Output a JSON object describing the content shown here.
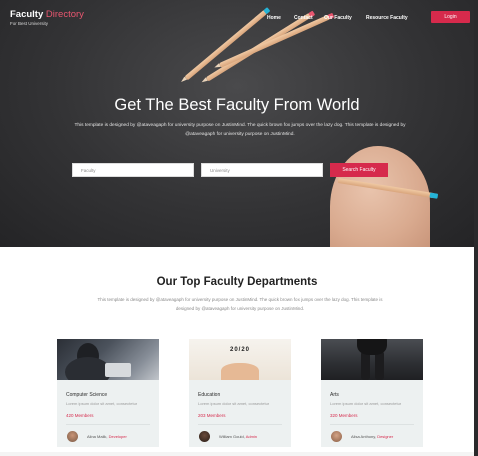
{
  "brand": {
    "name": "Faculty",
    "name_accent": "Directory",
    "subtitle": "For Best University"
  },
  "nav": {
    "items": [
      "Home",
      "Contact",
      "Our Faculty",
      "Resource Faculty"
    ],
    "login": "Login"
  },
  "hero": {
    "title": "Get The Best Faculty From World",
    "description": "This template is designed by @ataveagaph for university purpose on JustinMind. The quick brown fox jumps over the lazy dog. This template is designed by @ataveagaph for university purpose on JustinMind.",
    "search": {
      "field1_placeholder": "Faculty",
      "field2_placeholder": "University",
      "button": "Search Faculty"
    }
  },
  "departments": {
    "title": "Our Top Faculty Departments",
    "description": "This template is designed by @ataveagaph for university purpose on JustinMind. The quick brown fox jumps over the lazy dog. This template is designed by @ataveagaph for university purpose on JustinMind.",
    "cards": [
      {
        "category": "Computer Science",
        "desc": "Lorem ipsum dolor sit amet, consectetur",
        "members": "420 Members",
        "author": "Alina Malik,",
        "author_link": "Developer"
      },
      {
        "category": "Education",
        "image_caption": "20/20",
        "desc": "Lorem ipsum dolor sit amet, consectetur",
        "members": "203 Members",
        "author": "William Gould,",
        "author_link": "Admin"
      },
      {
        "category": "Arts",
        "desc": "Lorem ipsum dolor sit amet, consectetur",
        "members": "320 Members",
        "author": "Alisa Anthony,",
        "author_link": "Designer"
      }
    ]
  },
  "colors": {
    "accent": "#d62a4c",
    "hero_bg": "#333335",
    "card_bg": "#edf1f1",
    "pencil_cap": "#25b3d6"
  }
}
